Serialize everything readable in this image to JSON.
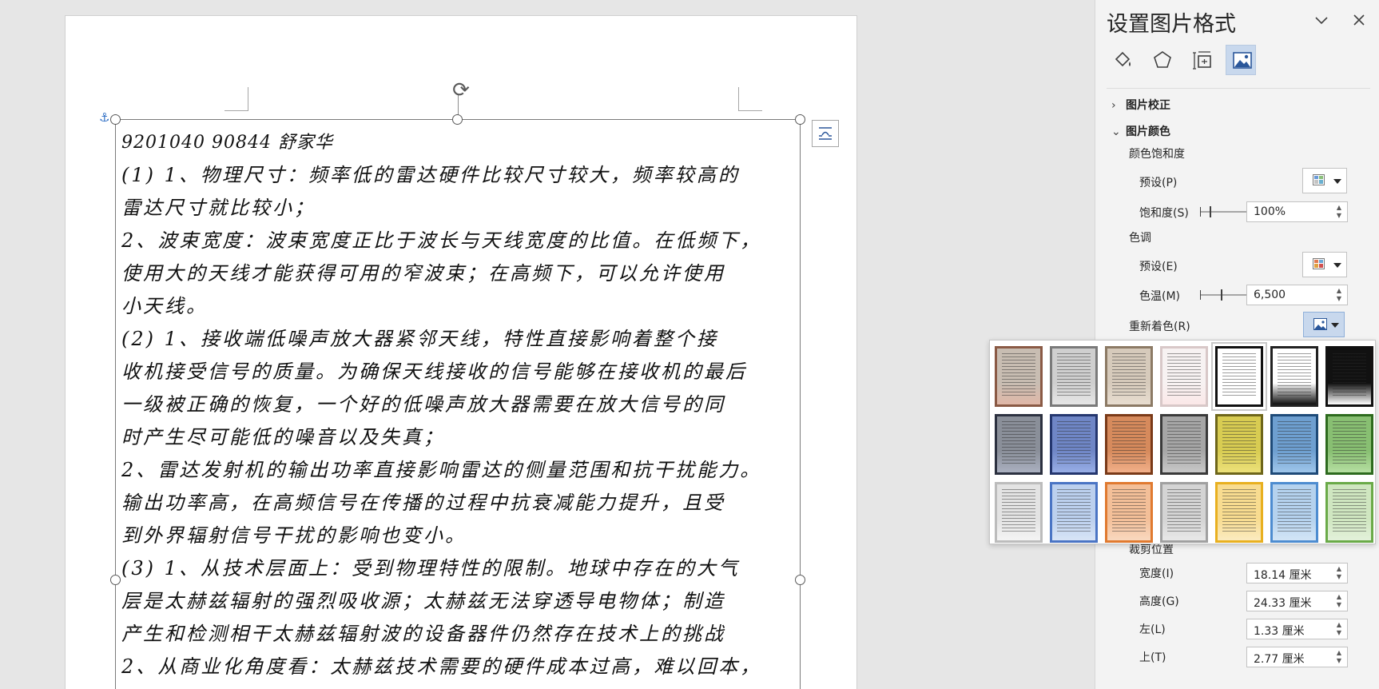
{
  "document": {
    "handwriting_lines": [
      "9201040 90844  舒家华",
      " (1) 1、物理尺寸：频率低的雷达硬件比较尺寸较大，频率较高的",
      "雷达尺寸就比较小；",
      "2、波束宽度：波束宽度正比于波长与天线宽度的比值。在低频下，",
      "使用大的天线才能获得可用的窄波束；在高频下，可以允许使用",
      "小天线。",
      " (2) 1、接收端低噪声放大器紧邻天线，特性直接影响着整个接",
      "收机接受信号的质量。为确保天线接收的信号能够在接收机的最后",
      "一级被正确的恢复，一个好的低噪声放大器需要在放大信号的同",
      "时产生尽可能低的噪音以及失真；",
      "2、雷达发射机的输出功率直接影响雷达的侧量范围和抗干扰能力。",
      "输出功率高，在高频信号在传播的过程中抗衰减能力提升，且受",
      "到外界辐射信号干扰的影响也变小。",
      " (3) 1、从技术层面上：受到物理特性的限制。地球中存在的大气",
      "层是太赫兹辐射的强烈吸收源；太赫兹无法穿透导电物体；制造",
      "产生和检测相干太赫兹辐射波的设备器件仍然存在技术上的挑战",
      "2、从商业化角度看：太赫兹技术需要的硬件成本过高，难以回本，"
    ]
  },
  "pane": {
    "title": "设置图片格式",
    "tabs": [
      "fill-line",
      "effects",
      "size-properties",
      "picture"
    ],
    "sections": {
      "correction": "图片校正",
      "color": "图片颜色"
    },
    "saturation": {
      "label": "颜色饱和度",
      "preset_label": "预设(P)",
      "slider_label": "饱和度(S)",
      "value": "100%"
    },
    "tone": {
      "label": "色调",
      "preset_label": "预设(E)",
      "slider_label": "色温(M)",
      "value": "6,500"
    },
    "recolor_label": "重新着色(R)",
    "crop": {
      "label": "裁剪位置",
      "width_label": "宽度(I)",
      "width_value": "18.14 厘米",
      "height_label": "高度(G)",
      "height_value": "24.33 厘米",
      "left_label": "左(L)",
      "left_value": "1.33 厘米",
      "top_label": "上(T)",
      "top_value": "2.77 厘米"
    }
  },
  "recolor_options": [
    {
      "bg": "#c8bdb2",
      "border": "#8a5a45",
      "fade": "#e0b8a8"
    },
    {
      "bg": "#cfcfcf",
      "border": "#7a7a7a",
      "fade": "#e6e6e6"
    },
    {
      "bg": "#d6cabb",
      "border": "#8c7a65",
      "fade": "#e8ddd0"
    },
    {
      "bg": "#f7f2f2",
      "border": "#d8c8c8",
      "fade": "#fbe8e8"
    },
    {
      "bg": "#ffffff",
      "border": "#111111",
      "fade": "#ffffff"
    },
    {
      "bg": "#ffffff",
      "border": "#222222",
      "fade": "#111111"
    },
    {
      "bg": "#111111",
      "border": "#111111",
      "fade": "#ffffff"
    },
    {
      "bg": "#8a8f99",
      "border": "#2c3140",
      "fade": "#aab0c0"
    },
    {
      "bg": "#6f86c6",
      "border": "#24366e",
      "fade": "#98aee6"
    },
    {
      "bg": "#d68a5c",
      "border": "#7a3a18",
      "fade": "#f2b08a"
    },
    {
      "bg": "#a6a6a6",
      "border": "#3a3a3a",
      "fade": "#c8c8c8"
    },
    {
      "bg": "#d8cc52",
      "border": "#6e661a",
      "fade": "#ece17a"
    },
    {
      "bg": "#6e9fd0",
      "border": "#1e4a78",
      "fade": "#9fc6ea"
    },
    {
      "bg": "#88bf72",
      "border": "#2d6a1e",
      "fade": "#b6dfa2"
    },
    {
      "bg": "#e3e3e3",
      "border": "#bcbcbc",
      "fade": "#f4f4f4"
    },
    {
      "bg": "#bcd0ee",
      "border": "#4a74c4",
      "fade": "#d8e4f6"
    },
    {
      "bg": "#f3bf98",
      "border": "#e07a30",
      "fade": "#f9d8bf"
    },
    {
      "bg": "#d4d4d4",
      "border": "#a0a0a0",
      "fade": "#e8e8e8"
    },
    {
      "bg": "#f8dc90",
      "border": "#e8b020",
      "fade": "#fbebc0"
    },
    {
      "bg": "#b5d2ee",
      "border": "#4d8cd0",
      "fade": "#d3e5f6"
    },
    {
      "bg": "#cfe6c0",
      "border": "#6aaa48",
      "fade": "#e3f1da"
    }
  ]
}
